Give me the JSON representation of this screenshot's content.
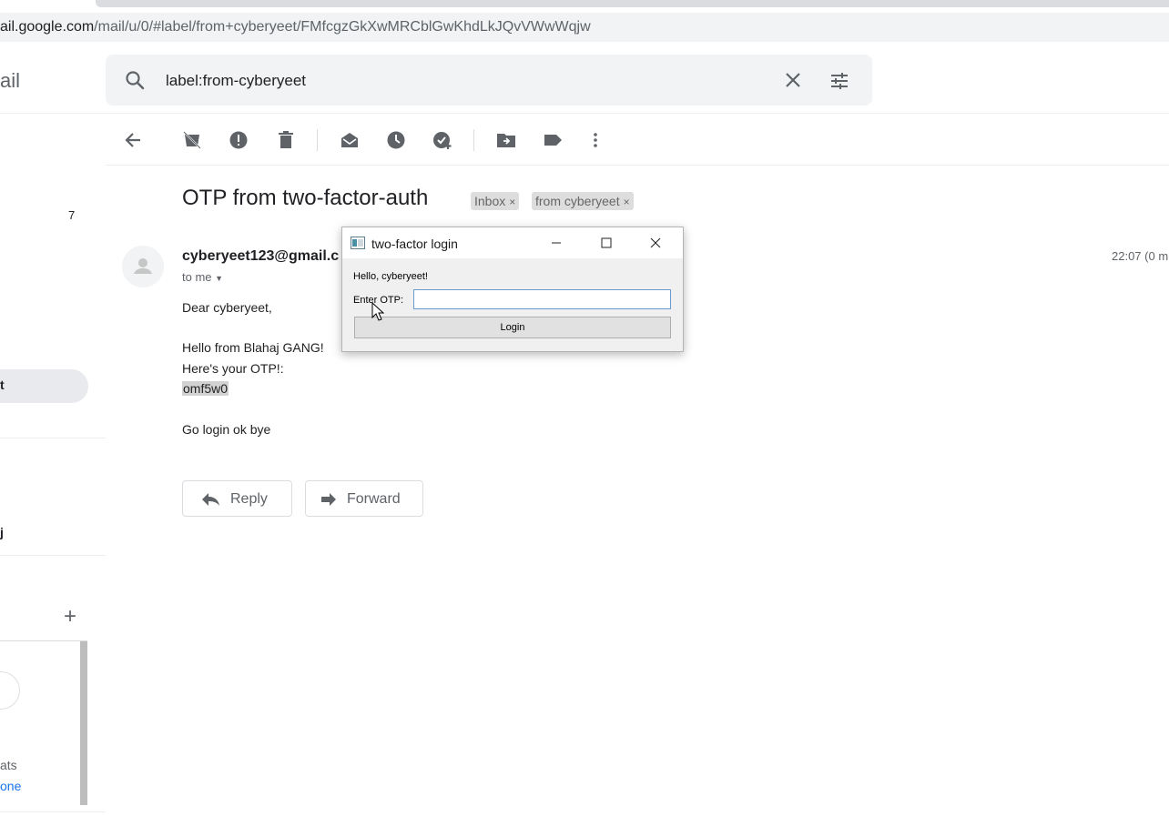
{
  "browser": {
    "url_host": "ail.google.com",
    "url_path": "/mail/u/0/#label/from+cyberyeet/FMfcgzGkXwMRCblGwKhdLkJQvVWwWqjw"
  },
  "header": {
    "logo_fragment": "ail",
    "search_value": "label:from-cyberyeet"
  },
  "sidebar": {
    "count": "7",
    "active_item_fragment": "t",
    "item_fragment_1": "j",
    "add_label_symbol": "+",
    "chat_fragment_1": "ats",
    "chat_fragment_2": "one"
  },
  "toolbar": {
    "icons": [
      "back-arrow-icon",
      "archive-icon",
      "report-spam-icon",
      "delete-icon",
      "mark-unread-icon",
      "snooze-icon",
      "add-to-tasks-icon",
      "move-to-icon",
      "labels-icon",
      "more-vert-icon"
    ]
  },
  "email": {
    "subject": "OTP from two-factor-auth",
    "labels": [
      {
        "name": "Inbox",
        "remove": "×"
      },
      {
        "name": "from cyberyeet",
        "remove": "×"
      }
    ],
    "sender": "cyberyeet123@gmail.c",
    "to": "to me",
    "time": "22:07 (0 m",
    "body": {
      "greeting": "Dear cyberyeet,",
      "line1": "Hello from Blahaj GANG!",
      "line2": "Here's your OTP!:",
      "otp": "omf5w0",
      "line3": "Go login ok bye"
    },
    "reply_label": "Reply",
    "forward_label": "Forward"
  },
  "dialog": {
    "title": "two-factor login",
    "hello": "Hello, cyberyeet!",
    "otp_label": "Enter OTP:",
    "otp_value": "",
    "login_label": "Login"
  },
  "colors": {
    "search_bg": "#f1f3f4",
    "chip_bg": "#dddddd",
    "link_blue": "#1a73e8",
    "dialog_bg": "#f0f0f0",
    "input_border": "#6b9bd1"
  }
}
